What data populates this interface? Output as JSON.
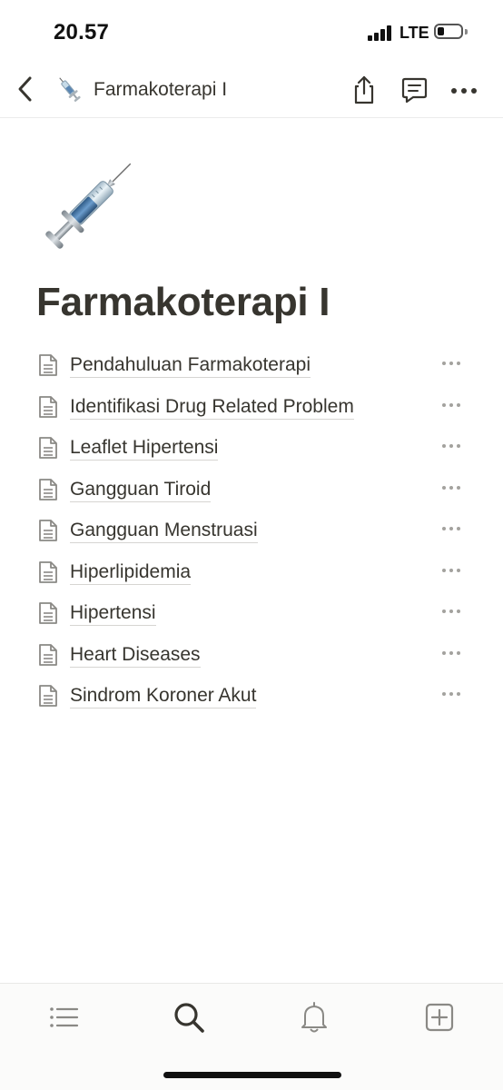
{
  "status_bar": {
    "time": "20.57",
    "network": "LTE"
  },
  "nav": {
    "title": "Farmakoterapi I",
    "icons": {
      "back": "chevron-left-icon",
      "page_emoji": "syringe-icon",
      "share": "share-icon",
      "comments": "comment-icon",
      "more": "more-horizontal-icon"
    }
  },
  "page": {
    "title": "Farmakoterapi I",
    "icon": "syringe-icon",
    "subpages": [
      {
        "label": "Pendahuluan Farmakoterapi"
      },
      {
        "label": "Identifikasi Drug Related Problem"
      },
      {
        "label": "Leaflet Hipertensi"
      },
      {
        "label": "Gangguan Tiroid"
      },
      {
        "label": "Gangguan Menstruasi"
      },
      {
        "label": "Hiperlipidemia"
      },
      {
        "label": "Hipertensi"
      },
      {
        "label": "Heart Diseases"
      },
      {
        "label": "Sindrom Koroner Akut"
      }
    ]
  },
  "bottom_tabs": [
    {
      "icon": "list-icon"
    },
    {
      "icon": "search-icon"
    },
    {
      "icon": "bell-icon"
    },
    {
      "icon": "add-page-icon"
    }
  ],
  "colors": {
    "text": "#37352f",
    "muted_icon": "#a3a29e",
    "underline": "#d6d5d2"
  }
}
